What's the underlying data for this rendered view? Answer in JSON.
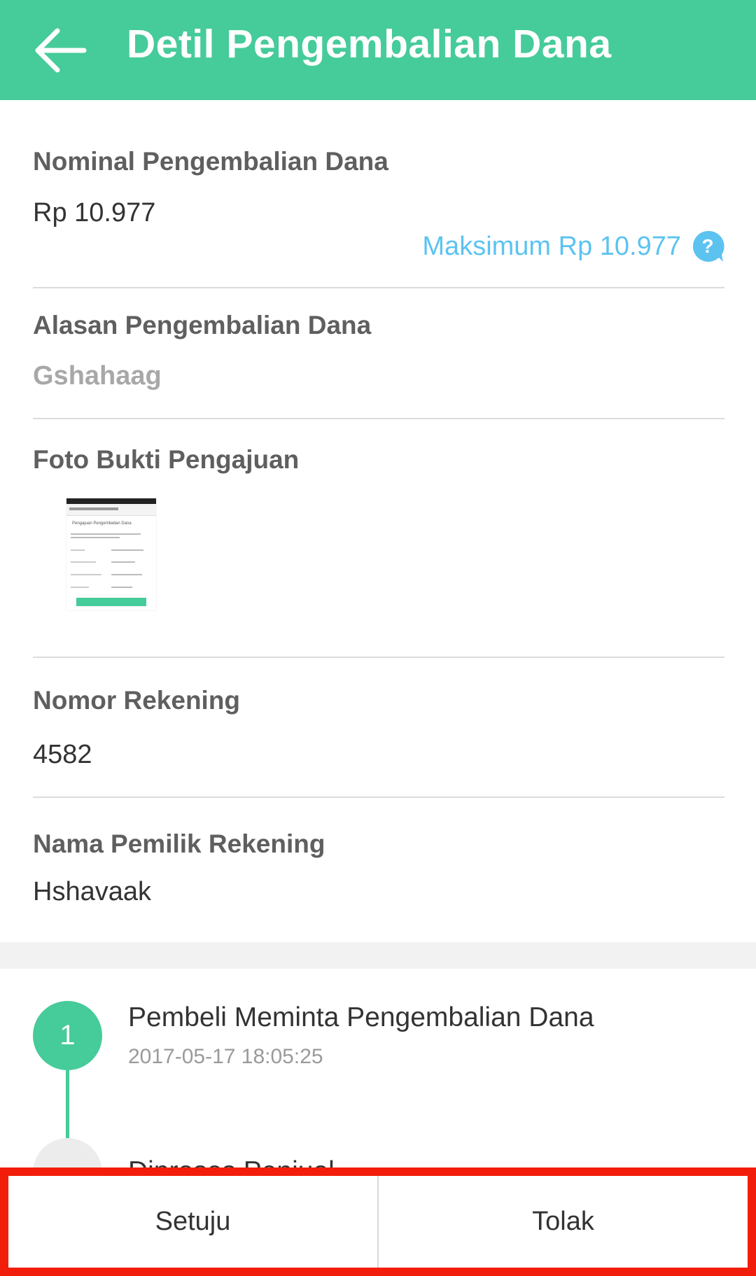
{
  "appbar": {
    "title": "Detil Pengembalian Dana"
  },
  "nominal": {
    "label": "Nominal Pengembalian Dana",
    "value": "Rp 10.977",
    "max_text": "Maksimum Rp 10.977"
  },
  "reason": {
    "label": "Alasan Pengembalian Dana",
    "value": "Gshahaag"
  },
  "photo": {
    "label": "Foto Bukti Pengajuan",
    "thumb_header": "Pengajuan Pengembalian Dana"
  },
  "account_number": {
    "label": "Nomor Rekening",
    "value": "4582"
  },
  "account_owner": {
    "label": "Nama Pemilik Rekening",
    "value": "Hshavaak"
  },
  "timeline": {
    "steps": [
      {
        "number": "1",
        "title": "Pembeli Meminta Pengembalian Dana",
        "time": "2017-05-17 18:05:25"
      },
      {
        "title": "Diproses Penjual"
      }
    ]
  },
  "actions": {
    "approve": "Setuju",
    "reject": "Tolak"
  },
  "colors": {
    "primary": "#46cb9a",
    "link": "#5cc3f1",
    "highlight": "#f31d0b"
  }
}
